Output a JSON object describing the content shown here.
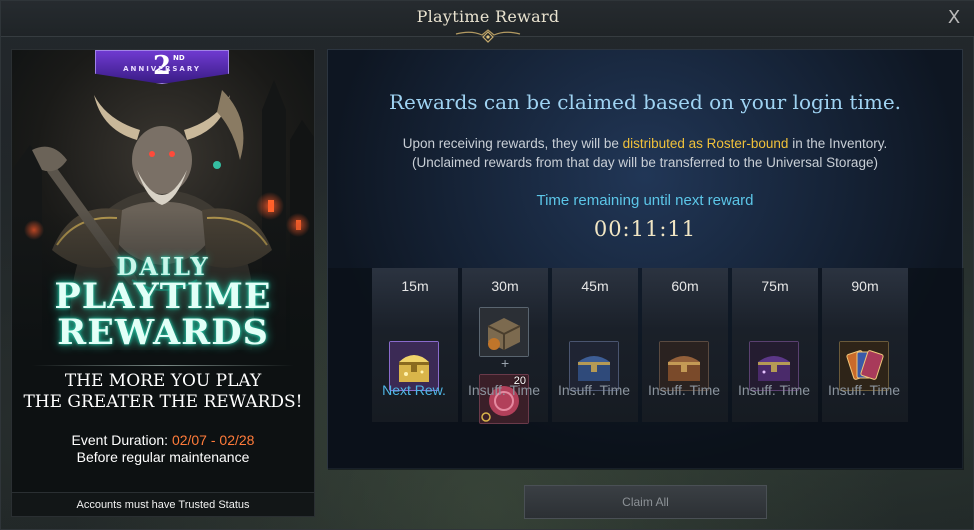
{
  "window": {
    "title": "Playtime Reward",
    "close_label": "X"
  },
  "banner": {
    "anniversary_number": "2",
    "anniversary_suffix": "ND",
    "anniversary_word": "ANNIVERSARY",
    "daily": "DAILY",
    "line1": "PLAYTIME",
    "line2": "REWARDS",
    "tagline1": "THE MORE YOU PLAY",
    "tagline2": "THE GREATER THE REWARDS!",
    "duration_label": "Event Duration: ",
    "duration_dates": "02/07 - 02/28",
    "maintenance": "Before regular maintenance",
    "trusted_notice": "Accounts must have Trusted Status"
  },
  "panel": {
    "headline": "Rewards can be claimed based on your login time.",
    "info1_a": "Upon receiving rewards, they will be ",
    "info1_highlight": "distributed as Roster-bound",
    "info1_b": " in the Inventory.",
    "info2": "(Unclaimed rewards from that day will be transferred to the Universal Storage)",
    "remaining_label": "Time remaining until next reward",
    "timer": "00:11:11"
  },
  "slots": [
    {
      "time": "15m",
      "status": "Next Rew.",
      "icon": "golden-chest-icon"
    },
    {
      "time": "30m",
      "status": "Insuff. Time",
      "icon": "crate-icon",
      "extra_icon": "coin-pouch-icon",
      "extra_qty": "20"
    },
    {
      "time": "45m",
      "status": "Insuff. Time",
      "icon": "blue-chest-icon"
    },
    {
      "time": "60m",
      "status": "Insuff. Time",
      "icon": "bronze-chest-icon"
    },
    {
      "time": "75m",
      "status": "Insuff. Time",
      "icon": "purple-chest-icon"
    },
    {
      "time": "90m",
      "status": "Insuff. Time",
      "icon": "card-pack-icon"
    }
  ],
  "footer": {
    "claim_all": "Claim All"
  },
  "colors": {
    "accent_blue": "#4fb6e6",
    "highlight_gold": "#f0c13a",
    "date_orange": "#ff7b3a",
    "banner_glow": "#1fc9a6"
  }
}
